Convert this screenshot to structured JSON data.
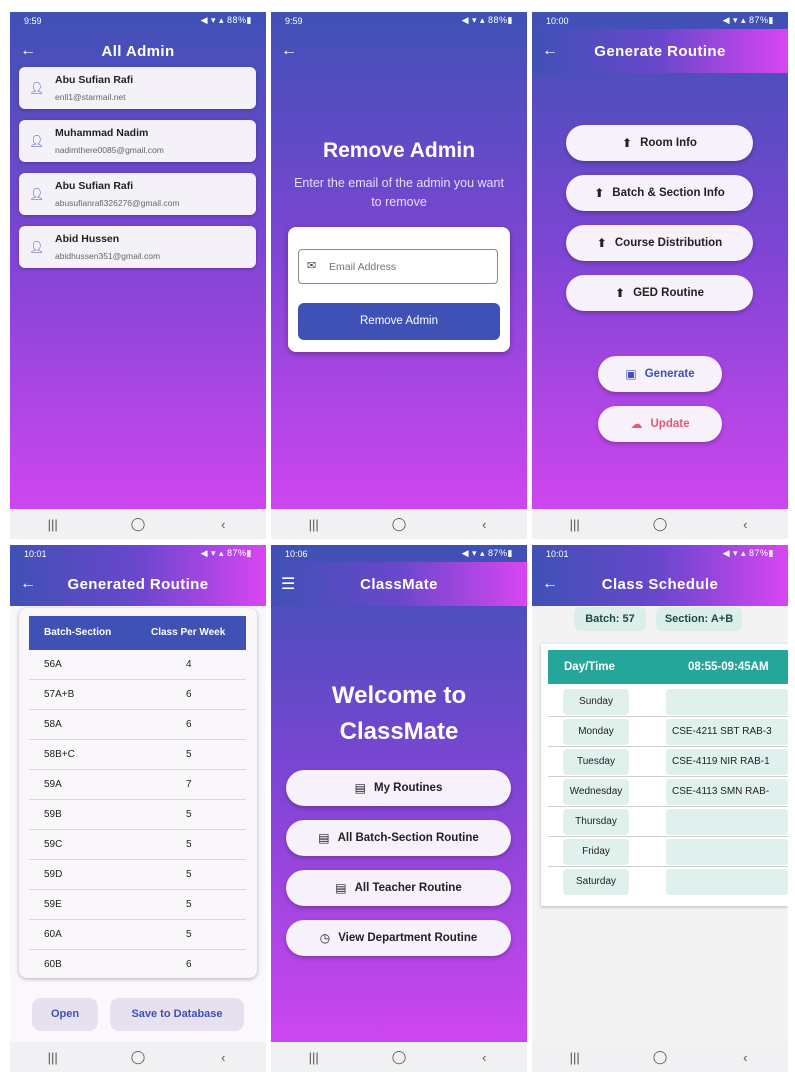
{
  "status": {
    "s1": {
      "time": "9:59",
      "right": "◀ ▾ ▴ 88%▮"
    },
    "s2": {
      "time": "9:59",
      "right": "◀ ▾ ▴ 88%▮"
    },
    "s3": {
      "time": "10:00",
      "right": "◀ ▾ ▴ 87%▮"
    },
    "s4": {
      "time": "10:01",
      "right": "◀ ▾ ▴ 87%▮"
    },
    "s5": {
      "time": "10:06",
      "right": "◀ ▾ ▴ 87%▮"
    },
    "s6": {
      "time": "10:01",
      "right": "◀ ▾ ▴ 87%▮"
    }
  },
  "nav": {
    "recents": "|||",
    "home": "◯",
    "back": "‹"
  },
  "screen1": {
    "title": "All Admin",
    "admins": [
      {
        "name": "Abu Sufian Rafi",
        "email": "enll1@starmail.net"
      },
      {
        "name": "Muhammad Nadim",
        "email": "nadimthere0085@gmail.com"
      },
      {
        "name": "Abu Sufian Rafi",
        "email": "abusufianrafi326276@gmail.com"
      },
      {
        "name": "Abid Hussen",
        "email": "abidhussen351@gmail.com"
      }
    ]
  },
  "screen2": {
    "heading": "Remove Admin",
    "subtitle": "Enter the email of the admin you want to remove",
    "email_placeholder": "Email Address",
    "button": "Remove Admin"
  },
  "screen3": {
    "title": "Generate Routine",
    "uploads": [
      "Room Info",
      "Batch & Section Info",
      "Course Distribution",
      "GED Routine"
    ],
    "generate": "Generate",
    "update": "Update"
  },
  "screen4": {
    "title": "Generated Routine",
    "col1": "Batch-Section",
    "col2": "Class Per Week",
    "rows": [
      {
        "bs": "56A",
        "cpw": "4"
      },
      {
        "bs": "57A+B",
        "cpw": "6"
      },
      {
        "bs": "58A",
        "cpw": "6"
      },
      {
        "bs": "58B+C",
        "cpw": "5"
      },
      {
        "bs": "59A",
        "cpw": "7"
      },
      {
        "bs": "59B",
        "cpw": "5"
      },
      {
        "bs": "59C",
        "cpw": "5"
      },
      {
        "bs": "59D",
        "cpw": "5"
      },
      {
        "bs": "59E",
        "cpw": "5"
      },
      {
        "bs": "60A",
        "cpw": "5"
      },
      {
        "bs": "60B",
        "cpw": "6"
      }
    ],
    "open": "Open",
    "save": "Save to Database"
  },
  "screen5": {
    "title": "ClassMate",
    "welcome_line1": "Welcome to",
    "welcome_line2": "ClassMate",
    "buttons": [
      "My Routines",
      "All Batch-Section Routine",
      "All Teacher Routine",
      "View Department Routine"
    ]
  },
  "screen6": {
    "title": "Class Schedule",
    "batch": "Batch: 57",
    "section": "Section: A+B",
    "col1": "Day/Time",
    "col2": "08:55-09:45AM",
    "days": [
      "Sunday",
      "Monday",
      "Tuesday",
      "Wednesday",
      "Thursday",
      "Friday",
      "Saturday"
    ],
    "slots": [
      "",
      "CSE-4211 SBT RAB-3",
      "CSE-4119 NIR RAB-1",
      "CSE-4113 SMN RAB-",
      "",
      "",
      ""
    ]
  }
}
